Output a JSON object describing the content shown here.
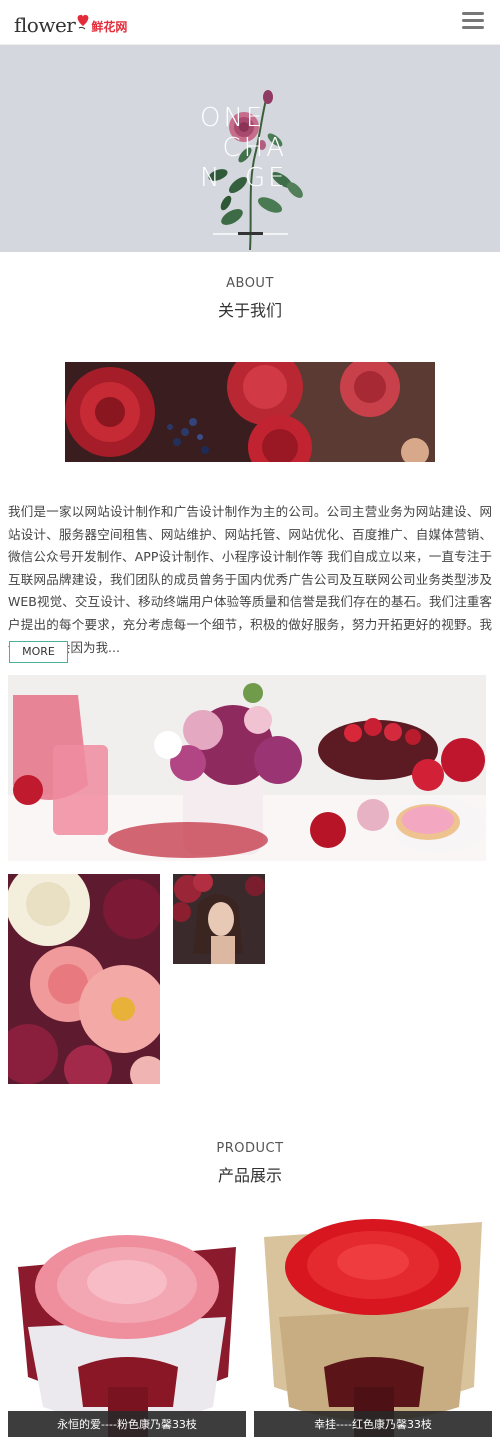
{
  "header": {
    "logo_en": "flower",
    "logo_cn": "鲜花网",
    "brand_color": "#e32c3a",
    "menu_icon": "hamburger-menu-icon"
  },
  "banner": {
    "lines": [
      "ONE",
      "  CHA",
      "N  GE"
    ],
    "background": "#d4d8de"
  },
  "about": {
    "title_en": "ABOUT",
    "title_cn": "关于我们",
    "text": "我们是一家以网站设计制作和广告设计制作为主的公司。公司主营业务为网站建设、网站设计、服务器空间租售、网站维护、网站托管、网站优化、百度推广、自媒体营销、微信公众号开发制作、APP设计制作、小程序设计制作等 我们自成立以来，一直专注于互联网品牌建设，我们团队的成员曾务于国内优秀广告公司及互联网公司业务类型涉及WEB视觉、交互设计、移动终端用户体验等质量和信誉是我们存在的基石。我们注重客户提出的每个要求，充分考虑每一个细节，积极的做好服务，努力开拓更好的视野。我们永远不会因为我...",
    "more_label": "MORE"
  },
  "product": {
    "title_en": "PRODUCT",
    "title_cn": "产品展示",
    "items": [
      {
        "caption": "永恒的爱----粉色康乃馨33枝"
      },
      {
        "caption": "幸挂----红色康乃馨33枝"
      }
    ]
  }
}
